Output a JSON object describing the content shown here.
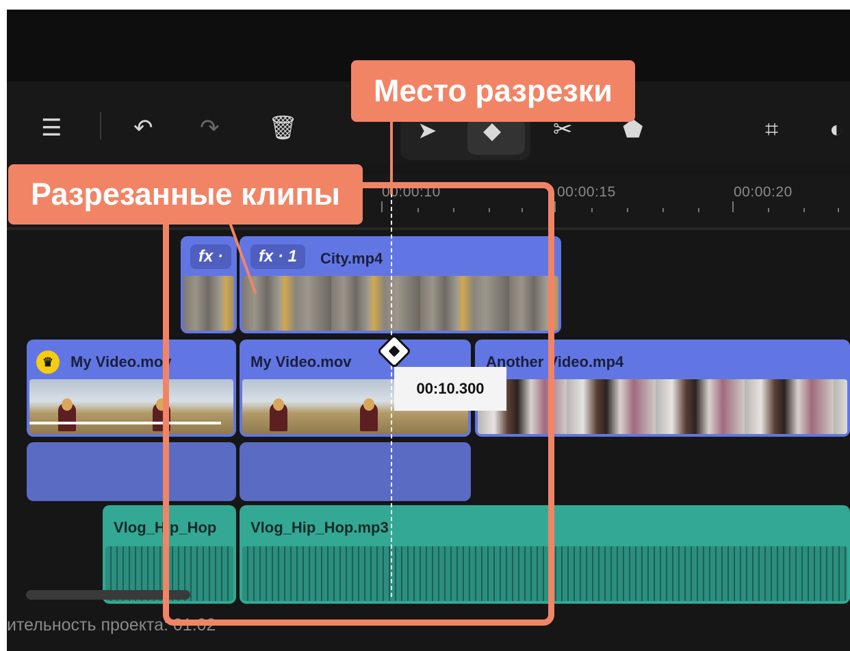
{
  "toolbar": {
    "icons": [
      "add-track-icon",
      "undo-icon",
      "redo-icon",
      "delete-icon",
      "pointer-tool-icon",
      "blade-tool-icon",
      "scissors-icon",
      "marker-icon",
      "crop-icon",
      "rotate-icon"
    ]
  },
  "ruler": {
    "labels": [
      "00:00:10",
      "00:00:15",
      "00:00:20"
    ]
  },
  "tracks": {
    "effect": {
      "left_clip": {
        "fx": "fx ·"
      },
      "right_clip": {
        "fx": "fx · 1",
        "name": "City.mp4"
      }
    },
    "video": {
      "left_clip": {
        "name": "My Video.mov"
      },
      "right_clip": {
        "name": "My Video.mov"
      },
      "next_clip": {
        "name": "Another Video.mp4"
      }
    },
    "audio": {
      "left_clip": {
        "name": "Vlog_Hip_Hop"
      },
      "right_clip": {
        "name": "Vlog_Hip_Hop.mp3"
      }
    }
  },
  "playhead": {
    "time": "00:10.300"
  },
  "footer": {
    "text": "ительность проекта: 01:02"
  },
  "annotations": {
    "cut_place": "Место разрезки",
    "cut_clips": "Разрезанные клипы"
  },
  "colors": {
    "video_clip": "#6276e3",
    "audio_clip": "#33a894",
    "callout": "#f28466",
    "premium_badge": "#f5cd0e"
  }
}
